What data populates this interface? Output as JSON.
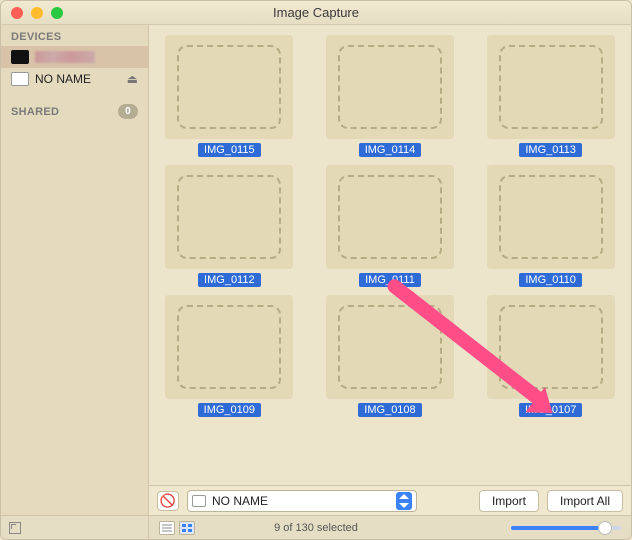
{
  "window": {
    "title": "Image Capture"
  },
  "sidebar": {
    "sections": [
      {
        "label": "DEVICES"
      },
      {
        "label": "SHARED",
        "badge": "0"
      }
    ],
    "items": [
      {
        "name_hidden": true,
        "icon": "phone"
      },
      {
        "name": "NO NAME",
        "icon": "disk",
        "ejectable": true
      }
    ]
  },
  "images": [
    {
      "name": "IMG_0115"
    },
    {
      "name": "IMG_0114"
    },
    {
      "name": "IMG_0113"
    },
    {
      "name": "IMG_0112"
    },
    {
      "name": "IMG_0111"
    },
    {
      "name": "IMG_0110"
    },
    {
      "name": "IMG_0109"
    },
    {
      "name": "IMG_0108"
    },
    {
      "name": "IMG_0107"
    }
  ],
  "importbar": {
    "destination": "NO NAME",
    "import_label": "Import",
    "import_all_label": "Import All"
  },
  "status": {
    "text": "9 of 130 selected"
  }
}
